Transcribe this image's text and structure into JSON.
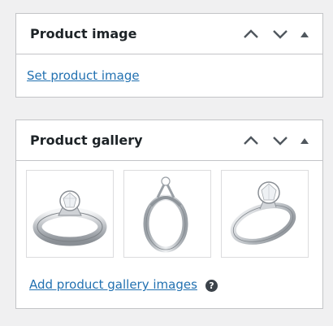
{
  "product_image": {
    "title": "Product image",
    "set_link": "Set product image"
  },
  "product_gallery": {
    "title": "Product gallery",
    "images": [
      {
        "icon": "ring-solitaire-front-image"
      },
      {
        "icon": "ring-side-view-image"
      },
      {
        "icon": "ring-angled-view-image"
      }
    ],
    "add_link": "Add product gallery images",
    "help_glyph": "?"
  },
  "colors": {
    "link": "#2271b1",
    "border": "#c3c4c7",
    "background": "#f0f0f1",
    "icon": "#50575e"
  },
  "icons": {
    "move_up": "chevron-up-icon",
    "move_down": "chevron-down-icon",
    "toggle": "caret-up-icon",
    "help": "help-circle-icon"
  }
}
